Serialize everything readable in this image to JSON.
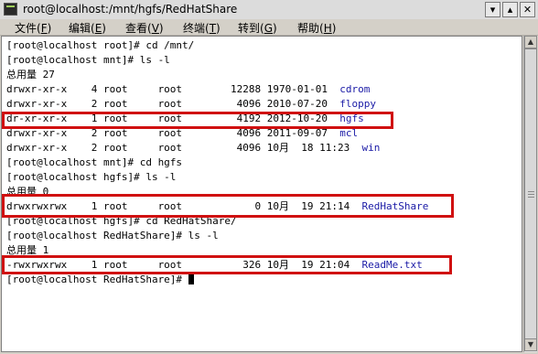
{
  "window": {
    "title": "root@localhost:/mnt/hgfs/RedHatShare",
    "min_glyph": "▾",
    "max_glyph": "▴",
    "close_glyph": "✕"
  },
  "menu": {
    "items": [
      {
        "label": "文件",
        "key": "F"
      },
      {
        "label": "编辑",
        "key": "E"
      },
      {
        "label": "查看",
        "key": "V"
      },
      {
        "label": "终端",
        "key": "T"
      },
      {
        "label": "转到",
        "key": "G"
      },
      {
        "label": "帮助",
        "key": "H"
      }
    ]
  },
  "terminal": {
    "lines": [
      {
        "text": "[root@localhost root]# cd /mnt/",
        "hl": ""
      },
      {
        "text": "[root@localhost mnt]# ls -l",
        "hl": ""
      },
      {
        "text": "总用量 27",
        "hl": ""
      },
      {
        "text": "drwxr-xr-x    4 root     root        12288 1970-01-01  ",
        "hl": "cdrom"
      },
      {
        "text": "drwxr-xr-x    2 root     root         4096 2010-07-20  ",
        "hl": "floppy"
      },
      {
        "text": "dr-xr-xr-x    1 root     root         4192 2012-10-20  ",
        "hl": "hgfs"
      },
      {
        "text": "drwxr-xr-x    2 root     root         4096 2011-09-07  ",
        "hl": "mcl"
      },
      {
        "text": "drwxr-xr-x    2 root     root         4096 10月  18 11:23  ",
        "hl": "win"
      },
      {
        "text": "[root@localhost mnt]# cd hgfs",
        "hl": ""
      },
      {
        "text": "[root@localhost hgfs]# ls -l",
        "hl": ""
      },
      {
        "text": "总用量 0",
        "hl": ""
      },
      {
        "text": "drwxrwxrwx    1 root     root            0 10月  19 21:14  ",
        "hl": "RedHatShare"
      },
      {
        "text": "[root@localhost hgfs]# cd RedHatShare/",
        "hl": ""
      },
      {
        "text": "[root@localhost RedHatShare]# ls -l",
        "hl": ""
      },
      {
        "text": "总用量 1",
        "hl": ""
      },
      {
        "text": "-rwxrwxrwx    1 root     root          326 10月  19 21:04  ",
        "hl": "ReadMe.txt"
      },
      {
        "text": "[root@localhost RedHatShare]# ",
        "hl": ""
      }
    ]
  },
  "scrollbar": {
    "up_glyph": "▲",
    "down_glyph": "▼"
  },
  "colors": {
    "highlight_box": "#d01010",
    "dir_text": "#1a1aa6"
  }
}
